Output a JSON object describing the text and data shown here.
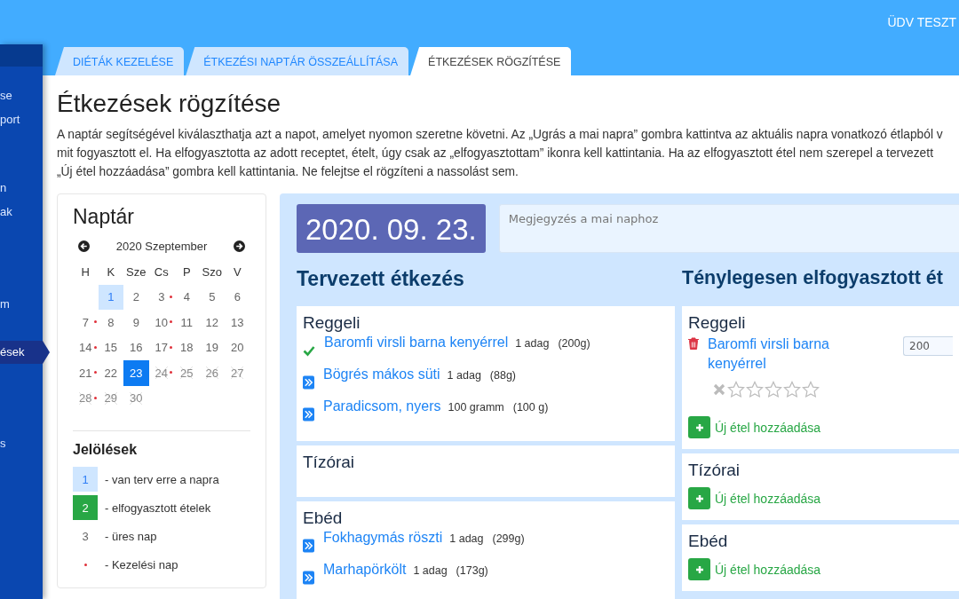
{
  "header": {
    "greeting": "ÜDV TESZT"
  },
  "sidebar": {
    "items": [
      {
        "label": "se",
        "selected": false
      },
      {
        "label": "port",
        "selected": false
      },
      {
        "label": "n",
        "selected": false
      },
      {
        "label": "ak",
        "selected": false
      },
      {
        "label": "m",
        "selected": false
      },
      {
        "label": "ések",
        "selected": true
      },
      {
        "label": "s",
        "selected": false
      }
    ]
  },
  "tabs": [
    {
      "label": "DIÉTÁK KEZELÉSE",
      "selected": false
    },
    {
      "label": "ÉTKEZÉSI NAPTÁR ÖSSZEÁLLÍTÁSA",
      "selected": false
    },
    {
      "label": "ÉTKEZÉSEK RÖGZÍTÉSE",
      "selected": true
    }
  ],
  "page": {
    "title": "Étkezések rögzítése",
    "intro_lines": [
      "A naptár segítségével kiválaszthatja azt a napot, amelyet nyomon szeretne követni. Az „Ugrás a mai napra” gombra kattintva az aktuális napra vonatkozó étlapból v",
      "mit fogyasztott el. Ha elfogyasztotta az adott receptet, ételt, úgy csak az „elfogyasztottam” ikonra kell kattintania. Ha az elfogyasztott étel nem szerepel a tervezett",
      "„Új étel hozzáadása” gombra kell kattintania. Ne felejtse el rögzíteni a nassolást sem."
    ]
  },
  "calendar": {
    "title": "Naptár",
    "month": "2020 Szeptember",
    "weekdays": [
      "H",
      "K",
      "Sze",
      "Cs",
      "P",
      "Szo",
      "V"
    ],
    "weeks": [
      [
        {
          "label": "1",
          "planned": true,
          "selected": false,
          "disabled": false,
          "treatment": false
        },
        {
          "label": "2",
          "planned": false,
          "selected": false,
          "disabled": false,
          "treatment": false
        },
        {
          "label": "3",
          "planned": false,
          "selected": false,
          "disabled": false,
          "treatment": true
        },
        {
          "label": "4",
          "planned": false,
          "selected": false,
          "disabled": false,
          "treatment": false
        },
        {
          "label": "5",
          "planned": false,
          "selected": false,
          "disabled": false,
          "treatment": false
        },
        {
          "label": "6",
          "planned": false,
          "selected": false,
          "disabled": false,
          "treatment": false
        }
      ],
      [
        {
          "label": "7",
          "planned": false,
          "selected": false,
          "disabled": false,
          "treatment": true
        },
        {
          "label": "8",
          "planned": false,
          "selected": false,
          "disabled": false,
          "treatment": false
        },
        {
          "label": "9",
          "planned": false,
          "selected": false,
          "disabled": false,
          "treatment": false
        },
        {
          "label": "10",
          "planned": false,
          "selected": false,
          "disabled": false,
          "treatment": true
        },
        {
          "label": "11",
          "planned": false,
          "selected": false,
          "disabled": false,
          "treatment": false
        },
        {
          "label": "12",
          "planned": false,
          "selected": false,
          "disabled": false,
          "treatment": false
        },
        {
          "label": "13",
          "planned": false,
          "selected": false,
          "disabled": false,
          "treatment": false
        }
      ],
      [
        {
          "label": "14",
          "planned": false,
          "selected": false,
          "disabled": false,
          "treatment": true
        },
        {
          "label": "15",
          "planned": false,
          "selected": false,
          "disabled": false,
          "treatment": false
        },
        {
          "label": "16",
          "planned": false,
          "selected": false,
          "disabled": false,
          "treatment": false
        },
        {
          "label": "17",
          "planned": false,
          "selected": false,
          "disabled": false,
          "treatment": true
        },
        {
          "label": "18",
          "planned": false,
          "selected": false,
          "disabled": false,
          "treatment": false
        },
        {
          "label": "19",
          "planned": false,
          "selected": false,
          "disabled": false,
          "treatment": false
        },
        {
          "label": "20",
          "planned": false,
          "selected": false,
          "disabled": false,
          "treatment": false
        }
      ],
      [
        {
          "label": "21",
          "planned": false,
          "selected": false,
          "disabled": false,
          "treatment": true
        },
        {
          "label": "22",
          "planned": false,
          "selected": false,
          "disabled": false,
          "treatment": false
        },
        {
          "label": "23",
          "planned": false,
          "selected": true,
          "disabled": false,
          "treatment": false
        },
        {
          "label": "24",
          "planned": false,
          "selected": false,
          "disabled": true,
          "treatment": true
        },
        {
          "label": "25",
          "planned": false,
          "selected": false,
          "disabled": true,
          "treatment": false
        },
        {
          "label": "26",
          "planned": false,
          "selected": false,
          "disabled": true,
          "treatment": false
        },
        {
          "label": "27",
          "planned": false,
          "selected": false,
          "disabled": true,
          "treatment": false
        }
      ],
      [
        {
          "label": "28",
          "planned": false,
          "selected": false,
          "disabled": true,
          "treatment": true
        },
        {
          "label": "29",
          "planned": false,
          "selected": false,
          "disabled": true,
          "treatment": false
        },
        {
          "label": "30",
          "planned": false,
          "selected": false,
          "disabled": true,
          "treatment": false
        }
      ]
    ],
    "legend_title": "Jelölések",
    "legend": [
      {
        "kind": "planned",
        "sample": "1",
        "text": "- van terv erre a napra"
      },
      {
        "kind": "eaten",
        "sample": "2",
        "text": "- elfogyasztott ételek"
      },
      {
        "kind": "empty",
        "sample": "3",
        "text": "- üres nap"
      },
      {
        "kind": "treatment",
        "text": "- Kezelési nap"
      }
    ]
  },
  "day": {
    "date": "2020. 09. 23.",
    "note_placeholder": "Megjegyzés a mai naphoz"
  },
  "planned": {
    "title": "Tervezett étkezés",
    "meals": [
      {
        "name": "Reggeli",
        "items": [
          {
            "name": "Baromfi virsli barna kenyérrel",
            "amount": "1 adag",
            "weight": "(200g)",
            "eaten": true
          },
          {
            "name": "Bögrés mákos süti",
            "amount": "1 adag",
            "weight": "(88g)",
            "eaten": false
          },
          {
            "name": "Paradicsom, nyers",
            "amount": "100 gramm",
            "weight": "(100 g)",
            "eaten": false
          }
        ]
      },
      {
        "name": "Tízórai"
      },
      {
        "name": "Ebéd",
        "items": [
          {
            "name": "Fokhagymás röszti",
            "amount": "1 adag",
            "weight": "(299g)",
            "eaten": false
          },
          {
            "name": "Marhapörkölt",
            "amount": "1 adag",
            "weight": "(173g)",
            "eaten": false
          }
        ]
      }
    ]
  },
  "actual": {
    "title": "Ténylegesen elfogyasztott ét",
    "meals": [
      {
        "name": "Reggeli",
        "items": [
          {
            "name": "Baromfi virsli barna kenyérrel",
            "quantity": "200",
            "stars": 0
          }
        ],
        "add_label": "Új étel hozzáadása"
      },
      {
        "name": "Tízórai",
        "add_label": "Új étel hozzáadása"
      },
      {
        "name": "Ebéd",
        "add_label": "Új étel hozzáadása"
      }
    ]
  }
}
